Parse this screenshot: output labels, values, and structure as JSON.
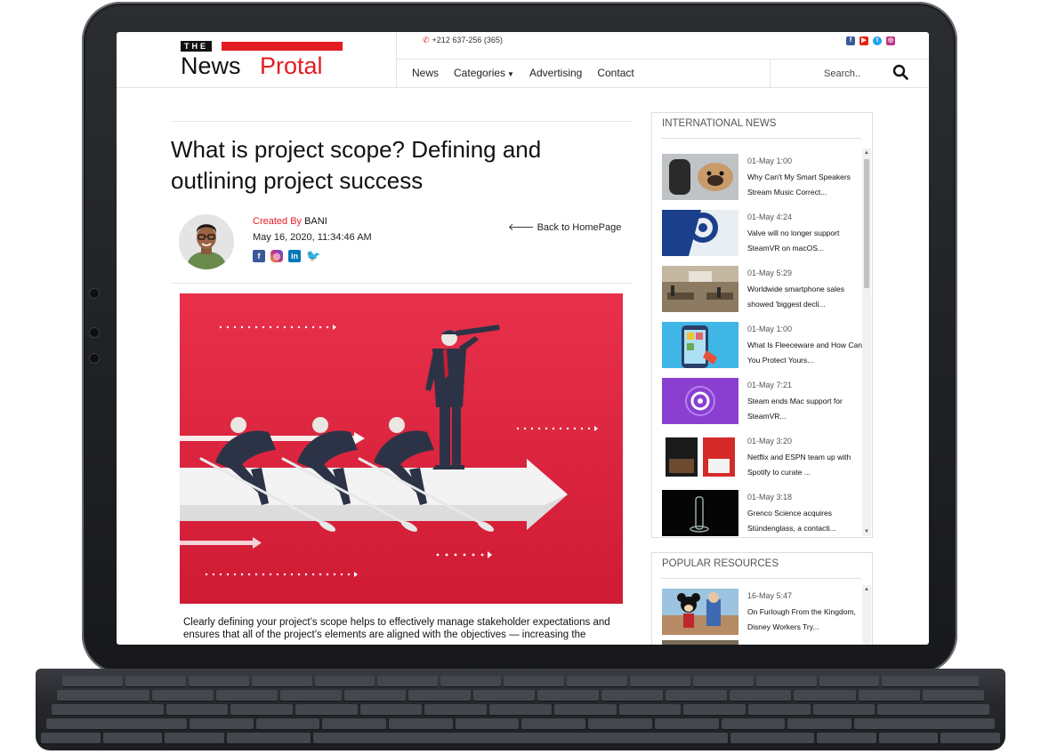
{
  "site": {
    "logo_the": "THE",
    "logo_news": "News",
    "logo_protal": "Protal",
    "phone": "+212 637-256 (365)",
    "social_top": [
      "facebook-icon",
      "youtube-icon",
      "twitter-icon",
      "instagram-icon"
    ],
    "search_placeholder": "Search.."
  },
  "nav": {
    "items": [
      "News",
      "Categories",
      "Advertising",
      "Contact"
    ]
  },
  "article": {
    "title": "What is project scope? Defining and outlining project success",
    "created_label": "Created By",
    "author": "BANI",
    "date": "May 16, 2020, 11:34:46 AM",
    "back_label": "Back to HomePage",
    "body": "Clearly defining your project’s scope helps to effectively manage stakeholder expectations and ensures that all of the project’s elements are aligned with the objectives — increasing the"
  },
  "sidebar": {
    "international": {
      "title": "INTERNATIONAL NEWS",
      "items": [
        {
          "time": "01-May 1:00",
          "title": "Why Can't My Smart Speakers Stream Music Correct..."
        },
        {
          "time": "01-May 4:24",
          "title": "Valve will no longer support SteamVR on macOS..."
        },
        {
          "time": "01-May 5:29",
          "title": "Worldwide smartphone sales showed 'biggest decli..."
        },
        {
          "time": "01-May 1:00",
          "title": "What Is Fleeceware and How Can You Protect Yours..."
        },
        {
          "time": "01-May 7:21",
          "title": "Steam ends Mac support for SteamVR..."
        },
        {
          "time": "01-May 3:20",
          "title": "Netflix and ESPN team up with Spotify to curate ..."
        },
        {
          "time": "01-May 3:18",
          "title": "Grenco Science acquires Stündenglass, a contacti..."
        }
      ]
    },
    "popular": {
      "title": "POPULAR RESOURCES",
      "items": [
        {
          "time": "16-May 5:47",
          "title": "On Furlough From the Kingdom, Disney Workers Try..."
        }
      ]
    }
  },
  "colors": {
    "brand_red": "#e31b23",
    "hero_red": "#e0203a"
  }
}
